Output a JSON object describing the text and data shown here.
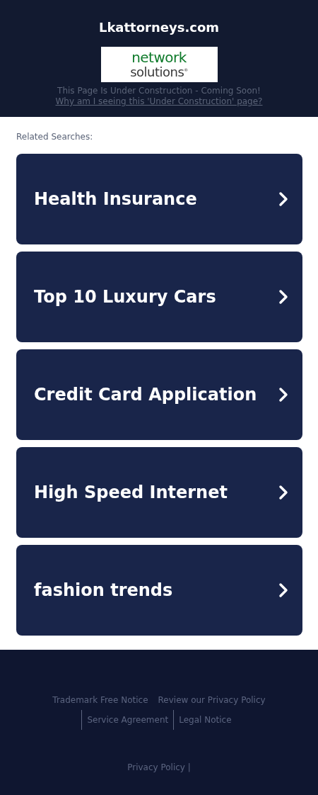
{
  "header": {
    "title": "Lkattorneys.com",
    "logo": {
      "line1": "network",
      "line2": "solutions",
      "mark": "®"
    },
    "notice": "This Page Is Under Construction - Coming Soon!",
    "why_link": "Why am I seeing this 'Under Construction' page?"
  },
  "related": {
    "heading": "Related Searches:",
    "items": [
      {
        "label": "Health Insurance"
      },
      {
        "label": "Top 10 Luxury Cars"
      },
      {
        "label": "Credit Card Application"
      },
      {
        "label": "High Speed Internet"
      },
      {
        "label": "fashion trends"
      }
    ]
  },
  "footer": {
    "links": [
      "Trademark Free Notice",
      "Review our Privacy Policy",
      "Service Agreement",
      "Legal Notice"
    ],
    "bottom": "Privacy Policy |"
  }
}
